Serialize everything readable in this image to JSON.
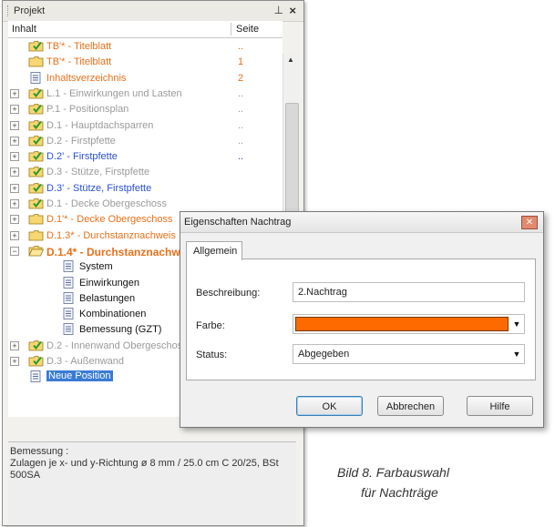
{
  "panel": {
    "title": "Projekt",
    "pin": "⊥",
    "close": "×",
    "columns": {
      "content": "Inhalt",
      "page": "Seite"
    }
  },
  "tree": [
    {
      "label": "TB'* - Titelblatt",
      "page": "..",
      "color": "#e8701a",
      "icon": "checked-folder-icon",
      "expander": ""
    },
    {
      "label": "TB'* - Titelblatt",
      "page": "1",
      "color": "#e8701a",
      "icon": "folder-icon",
      "expander": ""
    },
    {
      "label": "Inhaltsverzeichnis",
      "page": "2",
      "color": "#e8701a",
      "icon": "document-icon",
      "expander": ""
    },
    {
      "label": "L.1 - Einwirkungen und Lasten",
      "page": "..",
      "color": "#9a9a9a",
      "icon": "checked-folder-icon",
      "expander": "+"
    },
    {
      "label": "P.1 - Positionsplan",
      "page": "..",
      "color": "#9a9a9a",
      "icon": "checked-folder-icon",
      "expander": "+"
    },
    {
      "label": "D.1 - Hauptdachsparren",
      "page": "..",
      "color": "#9a9a9a",
      "icon": "checked-folder-icon",
      "expander": "+"
    },
    {
      "label": "D.2 - Firstpfette",
      "page": "..",
      "color": "#9a9a9a",
      "icon": "checked-folder-icon",
      "expander": "+"
    },
    {
      "label": "D.2' - Firstpfette",
      "page": "..",
      "color": "#2a4fd6",
      "icon": "checked-folder-icon",
      "expander": "+"
    },
    {
      "label": "D.3 - Stütze, Firstpfette",
      "page": "",
      "color": "#9a9a9a",
      "icon": "checked-folder-icon",
      "expander": "+"
    },
    {
      "label": "D.3' - Stütze, Firstpfette",
      "page": "",
      "color": "#2a4fd6",
      "icon": "checked-folder-icon",
      "expander": "+"
    },
    {
      "label": "D.1 - Decke Obergeschoss",
      "page": "",
      "color": "#9a9a9a",
      "icon": "checked-folder-icon",
      "expander": "+"
    },
    {
      "label": "D.1'* - Decke Obergeschoss",
      "page": "",
      "color": "#e8701a",
      "icon": "folder-icon",
      "expander": "+"
    },
    {
      "label": "D.1.3* - Durchstanznachweis",
      "page": "",
      "color": "#e8701a",
      "icon": "folder-icon",
      "expander": "+"
    },
    {
      "label": "D.1.4* - Durchstanznachweis",
      "page": "",
      "color": "#e8701a",
      "icon": "open-folder-icon",
      "expander": "−",
      "bold": true
    },
    {
      "label": "System",
      "page": "",
      "color": "#111111",
      "icon": "document-icon",
      "expander": "",
      "indent": 1
    },
    {
      "label": "Einwirkungen",
      "page": "",
      "color": "#111111",
      "icon": "document-icon",
      "expander": "",
      "indent": 1
    },
    {
      "label": "Belastungen",
      "page": "",
      "color": "#111111",
      "icon": "document-icon",
      "expander": "",
      "indent": 1
    },
    {
      "label": "Kombinationen",
      "page": "",
      "color": "#111111",
      "icon": "document-icon",
      "expander": "",
      "indent": 1
    },
    {
      "label": "Bemessung (GZT)",
      "page": "",
      "color": "#111111",
      "icon": "document-icon",
      "expander": "",
      "indent": 1
    },
    {
      "label": "D.2 - Innenwand Obergeschoss",
      "page": "",
      "color": "#9a9a9a",
      "icon": "checked-folder-icon",
      "expander": "+"
    },
    {
      "label": "D.3 - Außenwand",
      "page": "",
      "color": "#9a9a9a",
      "icon": "checked-folder-icon",
      "expander": "+"
    },
    {
      "label": "Neue Position",
      "page": "",
      "color": "#ffffff",
      "icon": "document-icon",
      "expander": "",
      "selected": true
    }
  ],
  "description": {
    "title": "Bemessung :",
    "text": "Zulagen je x- und y-Richtung ø 8 mm / 25.0 cm C 20/25, BSt 500SA"
  },
  "dialog": {
    "title": "Eigenschaften Nachtrag",
    "close": "✕",
    "tab": "Allgemein",
    "description_label": "Beschreibung:",
    "description_value": "2.Nachtrag",
    "color_label": "Farbe:",
    "color_value": "#ff6a00",
    "status_label": "Status:",
    "status_value": "Abgegeben",
    "buttons": {
      "ok": "OK",
      "cancel": "Abbrechen",
      "help": "Hilfe"
    }
  },
  "caption": {
    "line1": "Bild 8. Farbauswahl",
    "line2": "für Nachträge"
  }
}
